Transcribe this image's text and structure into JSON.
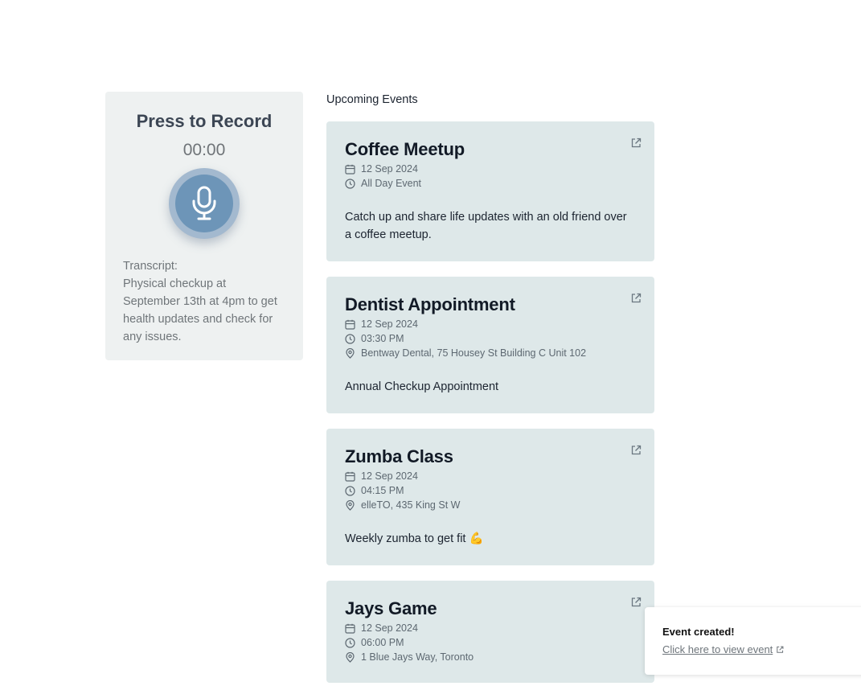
{
  "recorder": {
    "title": "Press to Record",
    "timer": "00:00",
    "transcript_label": "Transcript:",
    "transcript_text": "Physical checkup at September 13th at 4pm to get health updates and check for any issues."
  },
  "events": {
    "heading": "Upcoming Events",
    "items": [
      {
        "title": "Coffee Meetup",
        "date": "12 Sep 2024",
        "time": "All Day Event",
        "description": "Catch up and share life updates with an old friend over a coffee meetup."
      },
      {
        "title": "Dentist Appointment",
        "date": "12 Sep 2024",
        "time": "03:30 PM",
        "location": "Bentway Dental, 75 Housey St Building C Unit 102",
        "description": "Annual Checkup Appointment"
      },
      {
        "title": "Zumba Class",
        "date": "12 Sep 2024",
        "time": "04:15 PM",
        "location": "elleTO, 435 King St W",
        "description": "Weekly zumba to get fit 💪"
      },
      {
        "title": "Jays Game",
        "date": "12 Sep 2024",
        "time": "06:00 PM",
        "location": "1 Blue Jays Way, Toronto"
      }
    ]
  },
  "toast": {
    "title": "Event created!",
    "link_text": "Click here to view event"
  },
  "colors": {
    "panel_bg": "#eef1f1",
    "card_bg": "#dee8e9",
    "mic_ring": "#a3b9cf",
    "mic_fill": "#6d95b8"
  },
  "icons": [
    "microphone-icon",
    "calendar-icon",
    "clock-icon",
    "location-pin-icon",
    "external-link-icon"
  ]
}
